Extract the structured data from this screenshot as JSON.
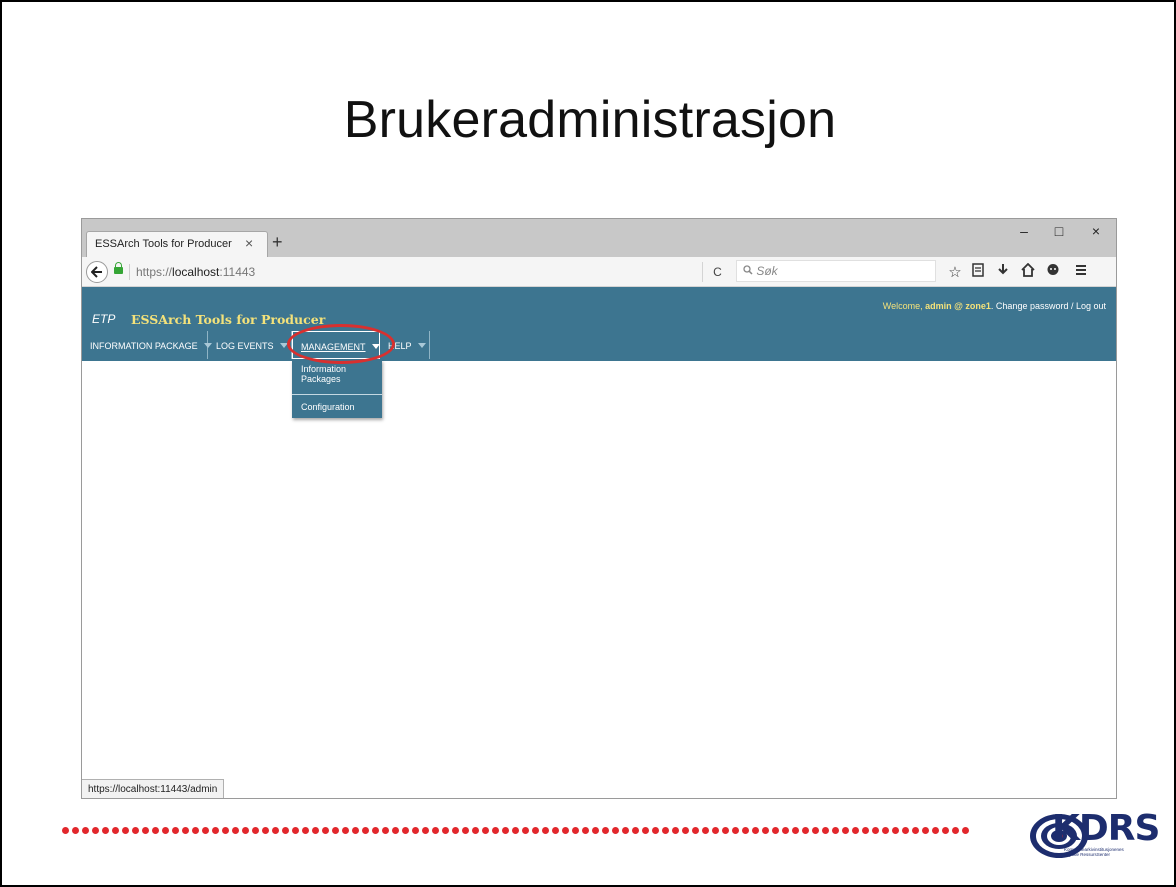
{
  "slide": {
    "title": "Brukeradministrasjon"
  },
  "browser": {
    "tab_title": "ESSArch Tools for Producer",
    "tab_close": "×",
    "new_tab": "+",
    "window_controls": {
      "minimize": "–",
      "maximize": "□",
      "close": "×"
    },
    "url_prefix": "https://",
    "url_host": "localhost",
    "url_suffix": ":11443",
    "reload": "C",
    "search_placeholder": "Søk",
    "toolbar_icons": [
      "star-icon",
      "reading-list-icon",
      "download-icon",
      "home-icon",
      "chat-icon",
      "menu-icon"
    ],
    "status_url": "https://localhost:11443/admin"
  },
  "app": {
    "short_name": "ETP",
    "name": "ESSArch Tools for Producer",
    "welcome_prefix": "Welcome, ",
    "user": "admin @ zone1",
    "account_links": ". Change password / Log out",
    "menu": [
      {
        "label": "INFORMATION PACKAGE"
      },
      {
        "label": "LOG EVENTS"
      },
      {
        "label": "MANAGEMENT"
      },
      {
        "label": "HELP"
      }
    ],
    "dropdown": [
      {
        "label_line1": "Information",
        "label_line2": "Packages"
      },
      {
        "label": "Configuration"
      }
    ]
  },
  "footer": {
    "logo_text": "KDRS",
    "logo_subtitle_line1": "Kommunearkivinstitusjonenes",
    "logo_subtitle_line2": "Digitale RessursSenter"
  },
  "colors": {
    "app_header": "#3d7590",
    "app_name": "#f4e27a",
    "highlight_ellipse": "#d8302f",
    "dots": "#e2272c",
    "logo": "#1d2d6e"
  }
}
